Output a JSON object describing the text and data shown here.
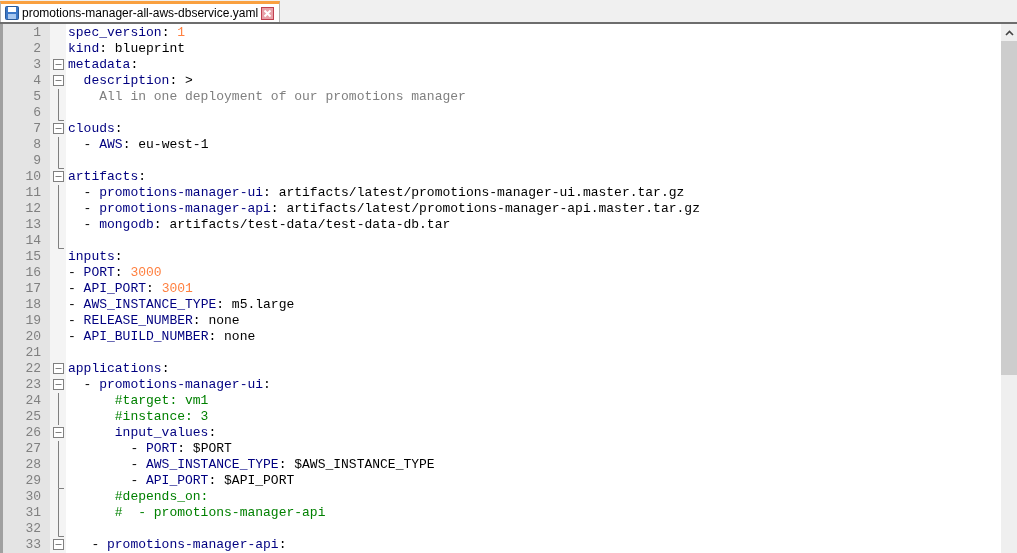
{
  "tab": {
    "title": "promotions-manager-all-aws-dbservice.yaml",
    "selected": true
  },
  "lines": [
    {
      "number": "1",
      "kind": "plain",
      "tokens": [
        {
          "kind": "key",
          "text": "spec_version"
        },
        {
          "kind": "text",
          "text": ": "
        },
        {
          "kind": "number",
          "text": "1"
        }
      ]
    },
    {
      "number": "2",
      "kind": "plain",
      "tokens": [
        {
          "kind": "key",
          "text": "kind"
        },
        {
          "kind": "text",
          "text": ": blueprint"
        }
      ]
    },
    {
      "number": "3",
      "kind": "foldstart",
      "tokens": [
        {
          "kind": "key",
          "text": "metadata"
        },
        {
          "kind": "text",
          "text": ":"
        }
      ]
    },
    {
      "number": "4",
      "kind": "foldstart",
      "tokens": [
        {
          "kind": "key",
          "text": "  description"
        },
        {
          "kind": "text",
          "text": ": >"
        }
      ]
    },
    {
      "number": "5",
      "kind": "foldline",
      "tokens": [
        {
          "kind": "folded",
          "text": "    All in one deployment of our promotions manager"
        }
      ]
    },
    {
      "number": "6",
      "kind": "foldend"
    },
    {
      "number": "7",
      "kind": "foldstart",
      "tokens": [
        {
          "kind": "key",
          "text": "clouds"
        },
        {
          "kind": "text",
          "text": ":"
        }
      ]
    },
    {
      "number": "8",
      "kind": "foldline",
      "tokens": [
        {
          "kind": "text",
          "text": "  - "
        },
        {
          "kind": "key",
          "text": "AWS"
        },
        {
          "kind": "text",
          "text": ": eu-west-1"
        }
      ]
    },
    {
      "number": "9",
      "kind": "foldend"
    },
    {
      "number": "10",
      "kind": "foldstart",
      "tokens": [
        {
          "kind": "key",
          "text": "artifacts"
        },
        {
          "kind": "text",
          "text": ":"
        }
      ]
    },
    {
      "number": "11",
      "kind": "foldline",
      "tokens": [
        {
          "kind": "text",
          "text": "  - "
        },
        {
          "kind": "key",
          "text": "promotions-manager-ui"
        },
        {
          "kind": "text",
          "text": ": artifacts/latest/promotions-manager-ui.master.tar.gz"
        }
      ]
    },
    {
      "number": "12",
      "kind": "foldline",
      "tokens": [
        {
          "kind": "text",
          "text": "  - "
        },
        {
          "kind": "key",
          "text": "promotions-manager-api"
        },
        {
          "kind": "text",
          "text": ": artifacts/latest/promotions-manager-api.master.tar.gz"
        }
      ]
    },
    {
      "number": "13",
      "kind": "foldline",
      "tokens": [
        {
          "kind": "text",
          "text": "  - "
        },
        {
          "kind": "key",
          "text": "mongodb"
        },
        {
          "kind": "text",
          "text": ": artifacts/test-data/test-data-db.tar"
        }
      ]
    },
    {
      "number": "14",
      "kind": "foldend"
    },
    {
      "number": "15",
      "kind": "plain",
      "tokens": [
        {
          "kind": "key",
          "text": "inputs"
        },
        {
          "kind": "text",
          "text": ":"
        }
      ]
    },
    {
      "number": "16",
      "kind": "plain",
      "tokens": [
        {
          "kind": "text",
          "text": "- "
        },
        {
          "kind": "key",
          "text": "PORT"
        },
        {
          "kind": "text",
          "text": ": "
        },
        {
          "kind": "number",
          "text": "3000"
        }
      ]
    },
    {
      "number": "17",
      "kind": "plain",
      "tokens": [
        {
          "kind": "text",
          "text": "- "
        },
        {
          "kind": "key",
          "text": "API_PORT"
        },
        {
          "kind": "text",
          "text": ": "
        },
        {
          "kind": "number",
          "text": "3001"
        }
      ]
    },
    {
      "number": "18",
      "kind": "plain",
      "tokens": [
        {
          "kind": "text",
          "text": "- "
        },
        {
          "kind": "key",
          "text": "AWS_INSTANCE_TYPE"
        },
        {
          "kind": "text",
          "text": ": m5.large"
        }
      ]
    },
    {
      "number": "19",
      "kind": "plain",
      "tokens": [
        {
          "kind": "text",
          "text": "- "
        },
        {
          "kind": "key",
          "text": "RELEASE_NUMBER"
        },
        {
          "kind": "text",
          "text": ": none"
        }
      ]
    },
    {
      "number": "20",
      "kind": "plain",
      "tokens": [
        {
          "kind": "text",
          "text": "- "
        },
        {
          "kind": "key",
          "text": "API_BUILD_NUMBER"
        },
        {
          "kind": "text",
          "text": ": none"
        }
      ]
    },
    {
      "number": "21",
      "kind": "plain"
    },
    {
      "number": "22",
      "kind": "foldstart",
      "tokens": [
        {
          "kind": "key",
          "text": "applications"
        },
        {
          "kind": "text",
          "text": ":"
        }
      ]
    },
    {
      "number": "23",
      "kind": "foldstart",
      "tokens": [
        {
          "kind": "text",
          "text": "  - "
        },
        {
          "kind": "key",
          "text": "promotions-manager-ui"
        },
        {
          "kind": "text",
          "text": ":"
        }
      ]
    },
    {
      "number": "24",
      "kind": "foldline",
      "tokens": [
        {
          "kind": "comment",
          "text": "      #target: vm1"
        }
      ]
    },
    {
      "number": "25",
      "kind": "foldline",
      "tokens": [
        {
          "kind": "comment",
          "text": "      #instance: 3"
        }
      ]
    },
    {
      "number": "26",
      "kind": "foldstart",
      "tokens": [
        {
          "kind": "key",
          "text": "      input_values"
        },
        {
          "kind": "text",
          "text": ":"
        }
      ]
    },
    {
      "number": "27",
      "kind": "foldline",
      "tokens": [
        {
          "kind": "text",
          "text": "        - "
        },
        {
          "kind": "key",
          "text": "PORT"
        },
        {
          "kind": "text",
          "text": ": $PORT"
        }
      ]
    },
    {
      "number": "28",
      "kind": "foldline",
      "tokens": [
        {
          "kind": "text",
          "text": "        - "
        },
        {
          "kind": "key",
          "text": "AWS_INSTANCE_TYPE"
        },
        {
          "kind": "text",
          "text": ": $AWS_INSTANCE_TYPE"
        }
      ]
    },
    {
      "number": "29",
      "kind": "foldend",
      "tokens": [
        {
          "kind": "text",
          "text": "        - "
        },
        {
          "kind": "key",
          "text": "API_PORT"
        },
        {
          "kind": "text",
          "text": ": $API_PORT"
        }
      ]
    },
    {
      "number": "30",
      "kind": "foldline",
      "tokens": [
        {
          "kind": "comment",
          "text": "      #depends_on:"
        }
      ]
    },
    {
      "number": "31",
      "kind": "foldline",
      "tokens": [
        {
          "kind": "comment",
          "text": "      #  - promotions-manager-api"
        }
      ]
    },
    {
      "number": "32",
      "kind": "foldend"
    },
    {
      "number": "33",
      "kind": "foldstart",
      "tokens": [
        {
          "kind": "text",
          "text": "   - "
        },
        {
          "kind": "key",
          "text": "promotions-manager-api"
        },
        {
          "kind": "text",
          "text": ":"
        }
      ]
    }
  ]
}
